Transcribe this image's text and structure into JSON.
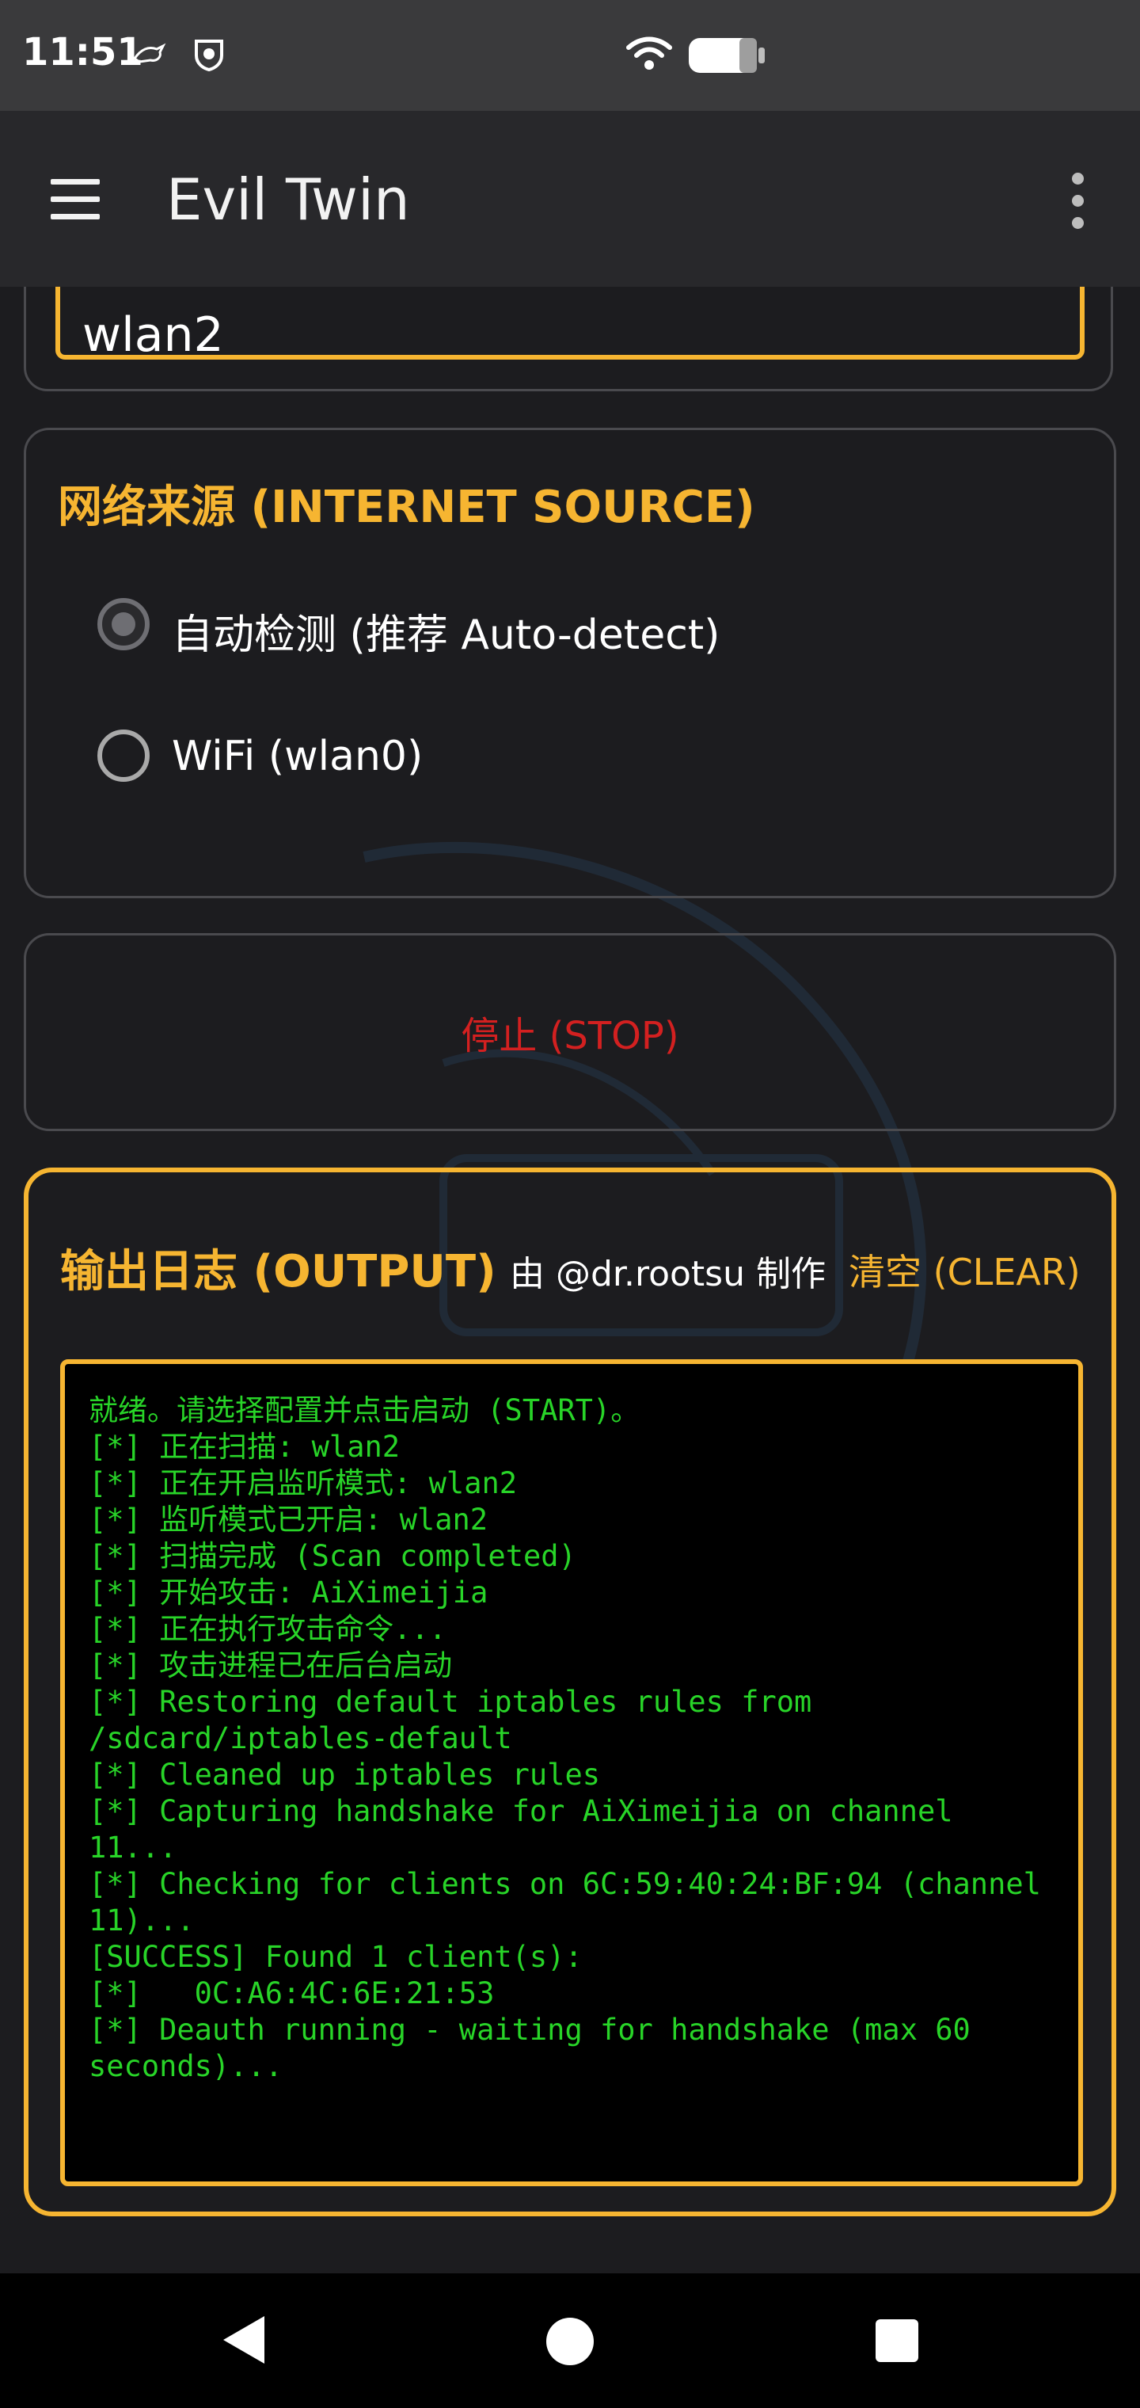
{
  "status_bar": {
    "time": "11:51"
  },
  "app_bar": {
    "title": "Evil Twin"
  },
  "interface": {
    "value": "wlan2"
  },
  "internet_source": {
    "title": "网络来源 (INTERNET SOURCE)",
    "options": [
      {
        "label": "自动检测 (推荐 Auto-detect)",
        "selected": true
      },
      {
        "label": "WiFi (wlan0)",
        "selected": false
      }
    ]
  },
  "stop_button": {
    "label": "停止 (STOP)"
  },
  "output": {
    "title": "输出日志 (OUTPUT)",
    "by_text": "由 @dr.rootsu 制作",
    "clear_label": "清空 (CLEAR)",
    "log_lines": [
      "就绪。请选择配置并点击启动 (START)。",
      "[*] 正在扫描: wlan2",
      "[*] 正在开启监听模式: wlan2",
      "[*] 监听模式已开启: wlan2",
      "[*] 扫描完成 (Scan completed)",
      "[*] 开始攻击: AiXimeijia",
      "[*] 正在执行攻击命令...",
      "[*] 攻击进程已在后台启动",
      "[*] Restoring default iptables rules from /sdcard/iptables-default",
      "[*] Cleaned up iptables rules",
      "[*] Capturing handshake for AiXimeijia on channel 11...",
      "[*] Checking for clients on 6C:59:40:24:BF:94 (channel 11)...",
      "[SUCCESS] Found 1 client(s):",
      "[*]   0C:A6:4C:6E:21:53",
      "[*] Deauth running - waiting for handshake (max 60 seconds)..."
    ]
  },
  "colors": {
    "accent": "#f6b531",
    "stop": "#d32020",
    "log_text": "#28d428",
    "background": "#1c1c1f"
  }
}
